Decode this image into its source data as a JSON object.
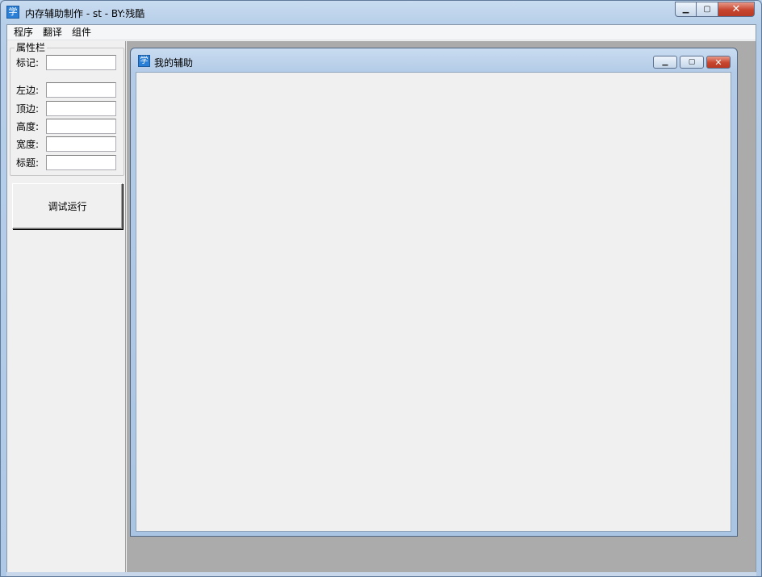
{
  "window": {
    "title": "内存辅助制作 - st - BY:残酷",
    "icon_glyph": "学",
    "accent_color": "#2a7fd6"
  },
  "menubar": {
    "items": [
      "程序",
      "翻译",
      "组件"
    ]
  },
  "properties": {
    "group_title": "属性栏",
    "fields": [
      {
        "label": "标记:",
        "value": ""
      },
      {
        "label": "左边:",
        "value": ""
      },
      {
        "label": "顶边:",
        "value": ""
      },
      {
        "label": "高度:",
        "value": ""
      },
      {
        "label": "宽度:",
        "value": ""
      },
      {
        "label": "标题:",
        "value": ""
      }
    ]
  },
  "actions": {
    "run_label": "调试运行"
  },
  "child_window": {
    "title": "我的辅助",
    "icon_glyph": "学"
  }
}
